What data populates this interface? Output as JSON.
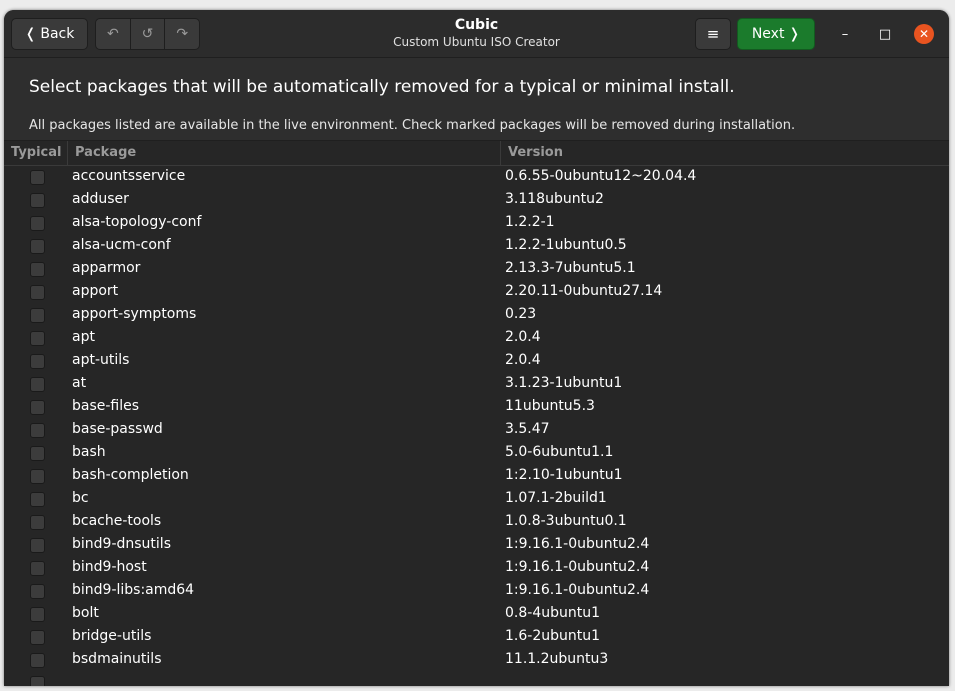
{
  "header": {
    "back_label": "Back",
    "back_icon": "❬",
    "undo_icon": "↶",
    "undo2_icon": "↺",
    "redo_icon": "↷",
    "title": "Cubic",
    "subtitle": "Custom Ubuntu ISO Creator",
    "menu_icon": "≡",
    "next_label": "Next",
    "next_icon": "❭",
    "min_icon": "–",
    "max_icon": "□",
    "close_icon": "✕",
    "accent": "#1b7b2c",
    "close_color": "#e95420"
  },
  "page": {
    "heading": "Select packages that will be automatically removed for a typical or minimal install.",
    "description": "All packages listed are available in the live environment. Check marked packages will be removed during installation."
  },
  "table": {
    "columns": [
      "Typical",
      "Package",
      "Version"
    ],
    "rows": [
      {
        "checked": false,
        "package": "accountsservice",
        "version": "0.6.55-0ubuntu12~20.04.4"
      },
      {
        "checked": false,
        "package": "adduser",
        "version": "3.118ubuntu2"
      },
      {
        "checked": false,
        "package": "alsa-topology-conf",
        "version": "1.2.2-1"
      },
      {
        "checked": false,
        "package": "alsa-ucm-conf",
        "version": "1.2.2-1ubuntu0.5"
      },
      {
        "checked": false,
        "package": "apparmor",
        "version": "2.13.3-7ubuntu5.1"
      },
      {
        "checked": false,
        "package": "apport",
        "version": "2.20.11-0ubuntu27.14"
      },
      {
        "checked": false,
        "package": "apport-symptoms",
        "version": "0.23"
      },
      {
        "checked": false,
        "package": "apt",
        "version": "2.0.4"
      },
      {
        "checked": false,
        "package": "apt-utils",
        "version": "2.0.4"
      },
      {
        "checked": false,
        "package": "at",
        "version": "3.1.23-1ubuntu1"
      },
      {
        "checked": false,
        "package": "base-files",
        "version": "11ubuntu5.3"
      },
      {
        "checked": false,
        "package": "base-passwd",
        "version": "3.5.47"
      },
      {
        "checked": false,
        "package": "bash",
        "version": "5.0-6ubuntu1.1"
      },
      {
        "checked": false,
        "package": "bash-completion",
        "version": "1:2.10-1ubuntu1"
      },
      {
        "checked": false,
        "package": "bc",
        "version": "1.07.1-2build1"
      },
      {
        "checked": false,
        "package": "bcache-tools",
        "version": "1.0.8-3ubuntu0.1"
      },
      {
        "checked": false,
        "package": "bind9-dnsutils",
        "version": "1:9.16.1-0ubuntu2.4"
      },
      {
        "checked": false,
        "package": "bind9-host",
        "version": "1:9.16.1-0ubuntu2.4"
      },
      {
        "checked": false,
        "package": "bind9-libs:amd64",
        "version": "1:9.16.1-0ubuntu2.4"
      },
      {
        "checked": false,
        "package": "bolt",
        "version": "0.8-4ubuntu1"
      },
      {
        "checked": false,
        "package": "bridge-utils",
        "version": "1.6-2ubuntu1"
      },
      {
        "checked": false,
        "package": "bsdmainutils",
        "version": "11.1.2ubuntu3"
      },
      {
        "checked": false,
        "package": "",
        "version": ""
      }
    ]
  }
}
